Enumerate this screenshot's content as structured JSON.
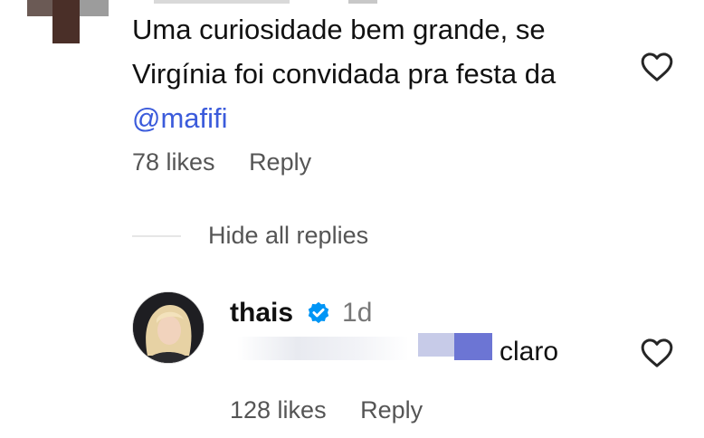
{
  "comment": {
    "text_line1": "Uma curiosidade bem grande, se",
    "text_line2": "Virgínia foi convidada pra festa da",
    "mention": "@mafifi",
    "likes": "78 likes",
    "reply_label": "Reply"
  },
  "replies_toggle": {
    "label": "Hide all replies"
  },
  "reply": {
    "username": "thais",
    "verified": true,
    "time": "1d",
    "text": "claro",
    "likes": "128 likes",
    "reply_label": "Reply"
  },
  "colors": {
    "mention": "#3b5bdb",
    "verified_badge": "#0095f6",
    "meta_text": "#555555"
  },
  "icons": {
    "comment_like": "heart-outline-icon",
    "reply_like": "heart-outline-icon",
    "verified": "verified-badge-icon"
  }
}
